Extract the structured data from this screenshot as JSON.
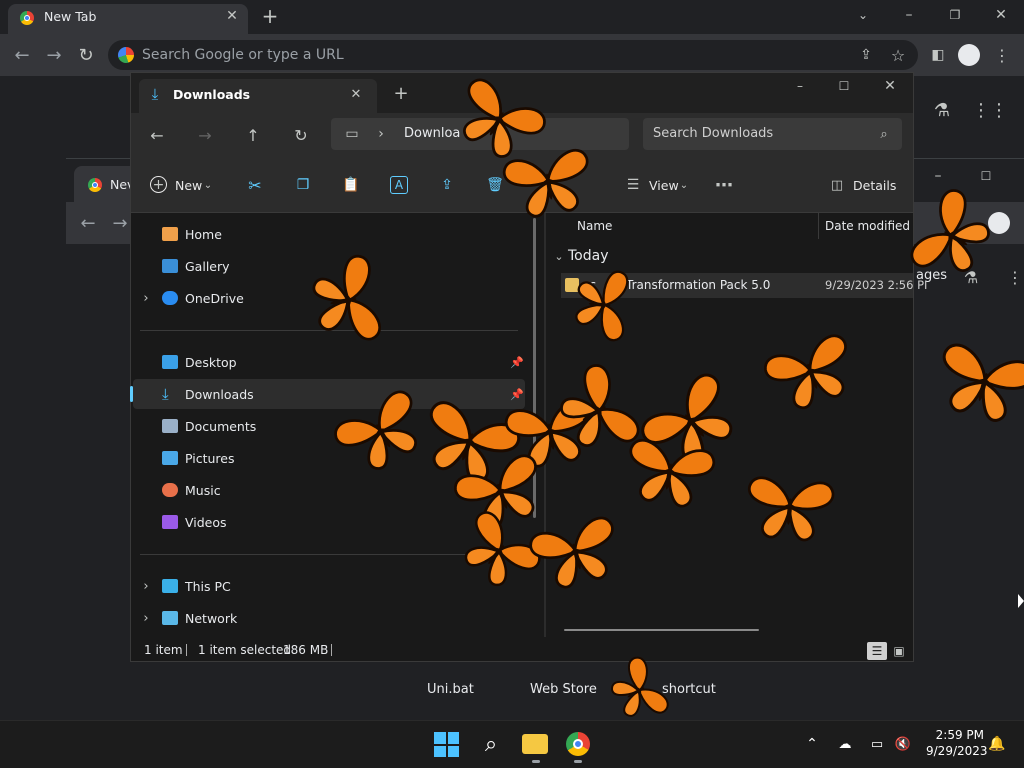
{
  "chrome": {
    "tab_title": "New Tab",
    "omnibox_placeholder": "Search Google or type a URL",
    "bg_tab_title": "Nev"
  },
  "explorer": {
    "tab_title": "Downloads",
    "address": "Downloa",
    "search_placeholder": "Search Downloads",
    "toolbar": {
      "new_label": "New",
      "view_label": "View",
      "details_label": "Details"
    },
    "nav": [
      {
        "label": "Home",
        "icon": "home-icon"
      },
      {
        "label": "Gallery",
        "icon": "gallery-icon"
      },
      {
        "label": "OneDrive",
        "icon": "cloud-icon"
      },
      {
        "label": "Desktop",
        "icon": "desktop-icon"
      },
      {
        "label": "Downloads",
        "icon": "download-icon"
      },
      {
        "label": "Documents",
        "icon": "document-icon"
      },
      {
        "label": "Pictures",
        "icon": "pictures-icon"
      },
      {
        "label": "Music",
        "icon": "music-icon"
      },
      {
        "label": "Videos",
        "icon": "videos-icon"
      },
      {
        "label": "This PC",
        "icon": "pc-icon"
      },
      {
        "label": "Network",
        "icon": "network-icon"
      }
    ],
    "columns": {
      "name": "Name",
      "date": "Date modified"
    },
    "group": "Today",
    "files": [
      {
        "name_prefix": "ac",
        "name": "Transformation Pack 5.0",
        "date": "9/29/2023 2:56 PI"
      }
    ],
    "status": {
      "count": "1 item",
      "selected": "1 item selected",
      "size": "186 MB"
    }
  },
  "desktop": {
    "shortcuts": [
      "Uni.bat",
      "Web Store",
      "shortcut"
    ],
    "peek_text": "ages"
  },
  "taskbar": {
    "time": "2:59 PM",
    "date": "9/29/2023"
  },
  "colors": {
    "accent": "#60cdff",
    "butterfly": "#f07c10",
    "butterfly_dark": "#1a0a00"
  }
}
